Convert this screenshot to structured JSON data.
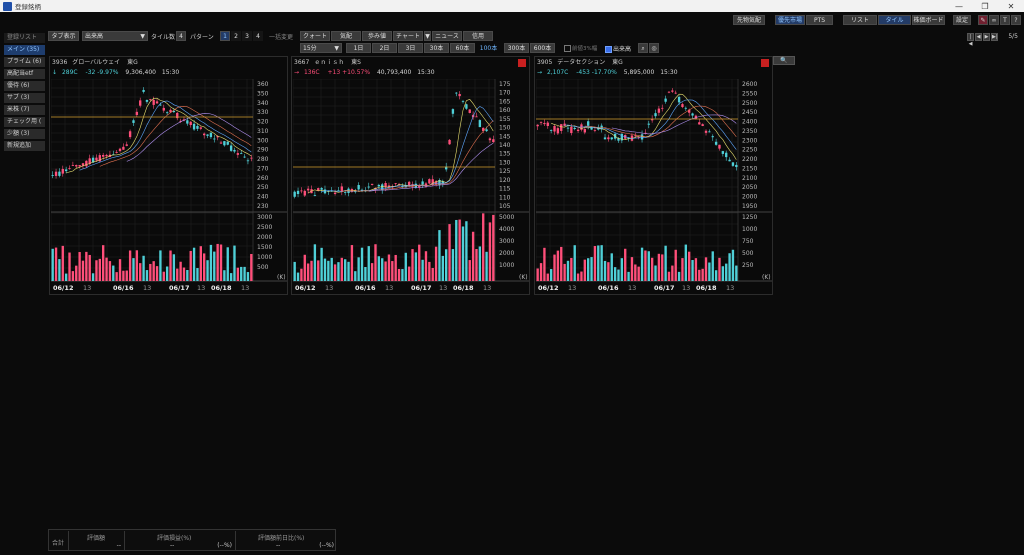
{
  "app": {
    "title": "登録銘柄"
  },
  "window_controls": {
    "minimize": "—",
    "restore": "❐",
    "close": "✕"
  },
  "topbar": {
    "futures": "先物気配",
    "priority_market": "優先市場",
    "pts": "PTS",
    "list": "リスト",
    "tile": "タイル",
    "board": "株価ボード",
    "settings": "設定",
    "help": "?",
    "text_btn": "T"
  },
  "toolbar": {
    "tab_display": "タブ表示",
    "volume_select": "出来高",
    "tile_count_label": "タイル数",
    "tile_count": "4",
    "pattern_label": "パターン",
    "patterns": [
      "1",
      "2",
      "3",
      "4"
    ],
    "bulk_change": "一括変更",
    "quote": "クォート",
    "depth": "気配",
    "walk": "歩み値",
    "chart": "チャート",
    "news": "ニュース",
    "credit": "信用",
    "interval": "15分",
    "periods": [
      "1日",
      "2日",
      "3日",
      "30本",
      "60本",
      "100本",
      "300本",
      "600本"
    ],
    "prev_close_toggle": "前値3%幅",
    "volume_toggle": "出来高"
  },
  "sidebar": {
    "header": "登録リスト",
    "items": [
      "メイン (35)",
      "プライム (6)",
      "高配当etf",
      "優待 (6)",
      "サブ (3)",
      "米株 (7)",
      "チェック用 (",
      "少額 (3)"
    ],
    "add_button": "新規追加"
  },
  "pager": {
    "first": "|◀",
    "prev": "◀",
    "next": "▶",
    "last": "▶|",
    "page": "5/5"
  },
  "search_button": "🔍",
  "tiles": [
    {
      "code": "3936",
      "name": "グローバルウェイ",
      "market": "東G",
      "arrow": "↓",
      "price": "289C",
      "change": "-32",
      "change_pct": "-9.97%",
      "volume": "9,306,400",
      "time": "15:30",
      "dir": "dn",
      "has_alert": false,
      "dates": [
        "06/12",
        "13",
        "06/16",
        "13",
        "06/17",
        "13",
        "06/18",
        "13"
      ],
      "price_ticks": [
        "360",
        "350",
        "340",
        "330",
        "320",
        "310",
        "300",
        "290",
        "280",
        "270",
        "260",
        "250",
        "240",
        "230"
      ],
      "volume_ticks": [
        "3000",
        "2500",
        "2000",
        "1500",
        "1000",
        "500",
        "(K)"
      ]
    },
    {
      "code": "3667",
      "name": "ｅｎｉｓｈ",
      "market": "東S",
      "arrow": "→",
      "price": "136C",
      "change": "+13",
      "change_pct": "+10.57%",
      "volume": "40,793,400",
      "time": "15:30",
      "dir": "up",
      "has_alert": true,
      "dates": [
        "06/12",
        "13",
        "06/16",
        "13",
        "06/17",
        "13",
        "06/18",
        "13"
      ],
      "price_ticks": [
        "175",
        "170",
        "165",
        "160",
        "155",
        "150",
        "145",
        "140",
        "135",
        "130",
        "125",
        "120",
        "115",
        "110",
        "105"
      ],
      "volume_ticks": [
        "5000",
        "4000",
        "3000",
        "2000",
        "1000",
        "(K)"
      ]
    },
    {
      "code": "3905",
      "name": "データセクション",
      "market": "東G",
      "arrow": "→",
      "price": "2,107C",
      "change": "-453",
      "change_pct": "-17.70%",
      "volume": "5,895,000",
      "time": "15:30",
      "dir": "dn",
      "has_alert": true,
      "dates": [
        "06/12",
        "13",
        "06/16",
        "13",
        "06/17",
        "13",
        "06/18",
        "13"
      ],
      "price_ticks": [
        "2600",
        "2550",
        "2500",
        "2450",
        "2400",
        "2350",
        "2300",
        "2250",
        "2200",
        "2150",
        "2100",
        "2050",
        "2000",
        "1950"
      ],
      "volume_ticks": [
        "1250",
        "1000",
        "750",
        "500",
        "250",
        "(K)"
      ]
    }
  ],
  "footer": {
    "total_label": "合計",
    "eval_amount": "評価額",
    "eval_pl": "評価損益(%)",
    "eval_prev": "評価額前日比(%)",
    "val1": "--",
    "val2": "--",
    "val2pct": "(--%)",
    "val3": "--",
    "val3pct": "(--%)"
  },
  "colors": {
    "up": "#ff4f7a",
    "down": "#4fd0d8",
    "accent": "#3a6ee8",
    "alert": "#c82020"
  }
}
